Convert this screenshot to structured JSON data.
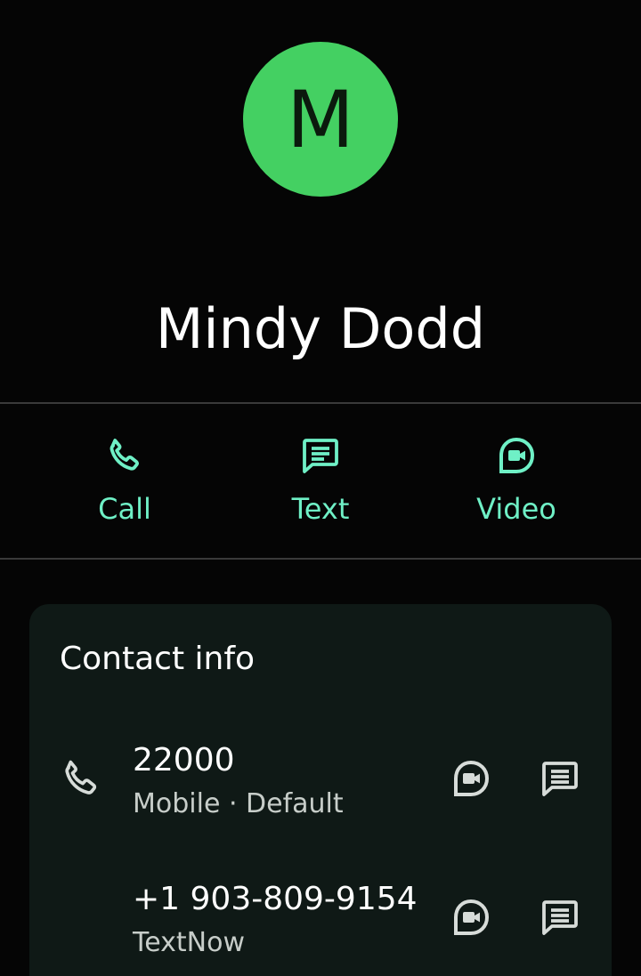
{
  "contact": {
    "initial": "M",
    "name": "Mindy Dodd",
    "avatar_color": "#44d062"
  },
  "actions": [
    {
      "label": "Call",
      "icon": "phone-icon"
    },
    {
      "label": "Text",
      "icon": "message-icon"
    },
    {
      "label": "Video",
      "icon": "video-call-icon"
    }
  ],
  "accent_color": "#6ff0c6",
  "contact_info": {
    "title": "Contact info",
    "entries": [
      {
        "number": "22000",
        "detail": "Mobile · Default",
        "lead_icon": "phone-icon"
      },
      {
        "number": "+1 903-809-9154",
        "detail": "TextNow",
        "lead_icon": ""
      }
    ]
  }
}
